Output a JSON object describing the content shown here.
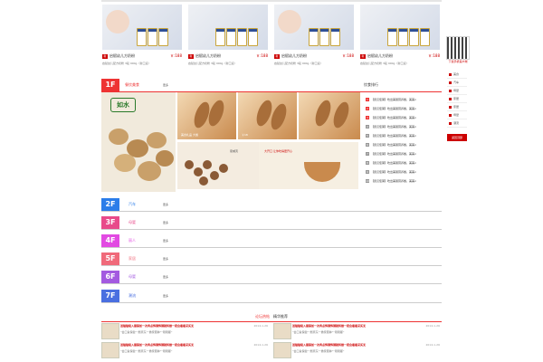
{
  "products": [
    {
      "name": "启赋幼儿方奶粉",
      "price": "￥:188",
      "desc": "启赋幼儿配方奶粉 3段 900g（新口运）"
    },
    {
      "name": "启赋幼儿方奶粉",
      "price": "￥:188",
      "desc": "启赋幼儿配方奶粉 3段 900g（新口运）"
    },
    {
      "name": "启赋幼儿方奶粉",
      "price": "￥:188",
      "desc": "启赋幼儿配方奶粉 3段 900g（新口运）"
    },
    {
      "name": "启赋幼儿方奶粉",
      "price": "￥:188",
      "desc": "启赋幼儿配方奶粉 3段 900g（新口运）"
    }
  ],
  "qr": {
    "caption": "下载手机客户端"
  },
  "sidenav": {
    "items": [
      "美食",
      "汽车",
      "母婴",
      "家居",
      "家居",
      "母婴",
      "潮流"
    ],
    "button": "返回顶部"
  },
  "floor1": {
    "num": "1F",
    "title": "餐饮美食",
    "more": "更多",
    "rank_title": "饮食排行",
    "logo": "如水",
    "tile_labels": [
      "美食礼品 大餐",
      "￥18"
    ],
    "mac_tag": "夏威夷",
    "alm_tag": "大开口 让你吃得更开心",
    "rank_rows": [
      "【武汉佳莱】吃出美丽营养餐，美美x",
      "【武汉佳莱】吃出美丽营养餐，美美x",
      "【武汉佳莱】吃出美丽营养餐，美美x",
      "【武汉佳莱】吃出美丽营养餐，美美x",
      "【武汉佳莱】吃出美丽营养餐，美美x",
      "【武汉佳莱】吃出美丽营养餐，美美x",
      "【武汉佳莱】吃出美丽营养餐，美美x",
      "【武汉佳莱】吃出美丽营养餐，美美x",
      "【武汉佳莱】吃出美丽营养餐，美美x",
      "【武汉佳莱】吃出美丽营养餐，美美x"
    ]
  },
  "floors": [
    {
      "num": "2F",
      "title": "汽车",
      "more": "更多",
      "color": "#2b7de9"
    },
    {
      "num": "3F",
      "title": "母婴",
      "more": "更多",
      "color": "#e84a8a"
    },
    {
      "num": "4F",
      "title": "丽人",
      "more": "更多",
      "color": "#e24ae2"
    },
    {
      "num": "5F",
      "title": "家居",
      "more": "更多",
      "color": "#f06a7a"
    },
    {
      "num": "6F",
      "title": "母婴",
      "more": "更多",
      "color": "#a35ae0"
    },
    {
      "num": "7F",
      "title": "潮流",
      "more": "更多",
      "color": "#4a6fe0"
    }
  ],
  "forum": {
    "tab_active": "论坛热帖",
    "tab_other": "精华推荐",
    "posts": [
      {
        "title": "送猫猫吸入服装如一次再点饰钢饰钢就将做一把会看看采买无",
        "excerpt": "“会口鱼保健”“剧离东”“撒家圈种”“刚刚都”",
        "date": "2014-1-26"
      },
      {
        "title": "送猫猫吸入服装如一次再点饰钢饰钢就将做一把会看看采买无",
        "excerpt": "“会口鱼保健”“剧离东”“撒家圈种”“刚刚都”",
        "date": "2014-1-26"
      },
      {
        "title": "送猫猫吸入服装如一次再点饰钢饰钢就将做一把会看看采买无",
        "excerpt": "“会口鱼保健”“剧离东”“撒家圈种”“刚刚都”",
        "date": "2014-1-26"
      },
      {
        "title": "送猫猫吸入服装如一次再点饰钢饰钢就将做一把会看看采买无",
        "excerpt": "“会口鱼保健”“剧离东”“撒家圈种”“刚刚都”",
        "date": "2014-1-26"
      }
    ]
  }
}
